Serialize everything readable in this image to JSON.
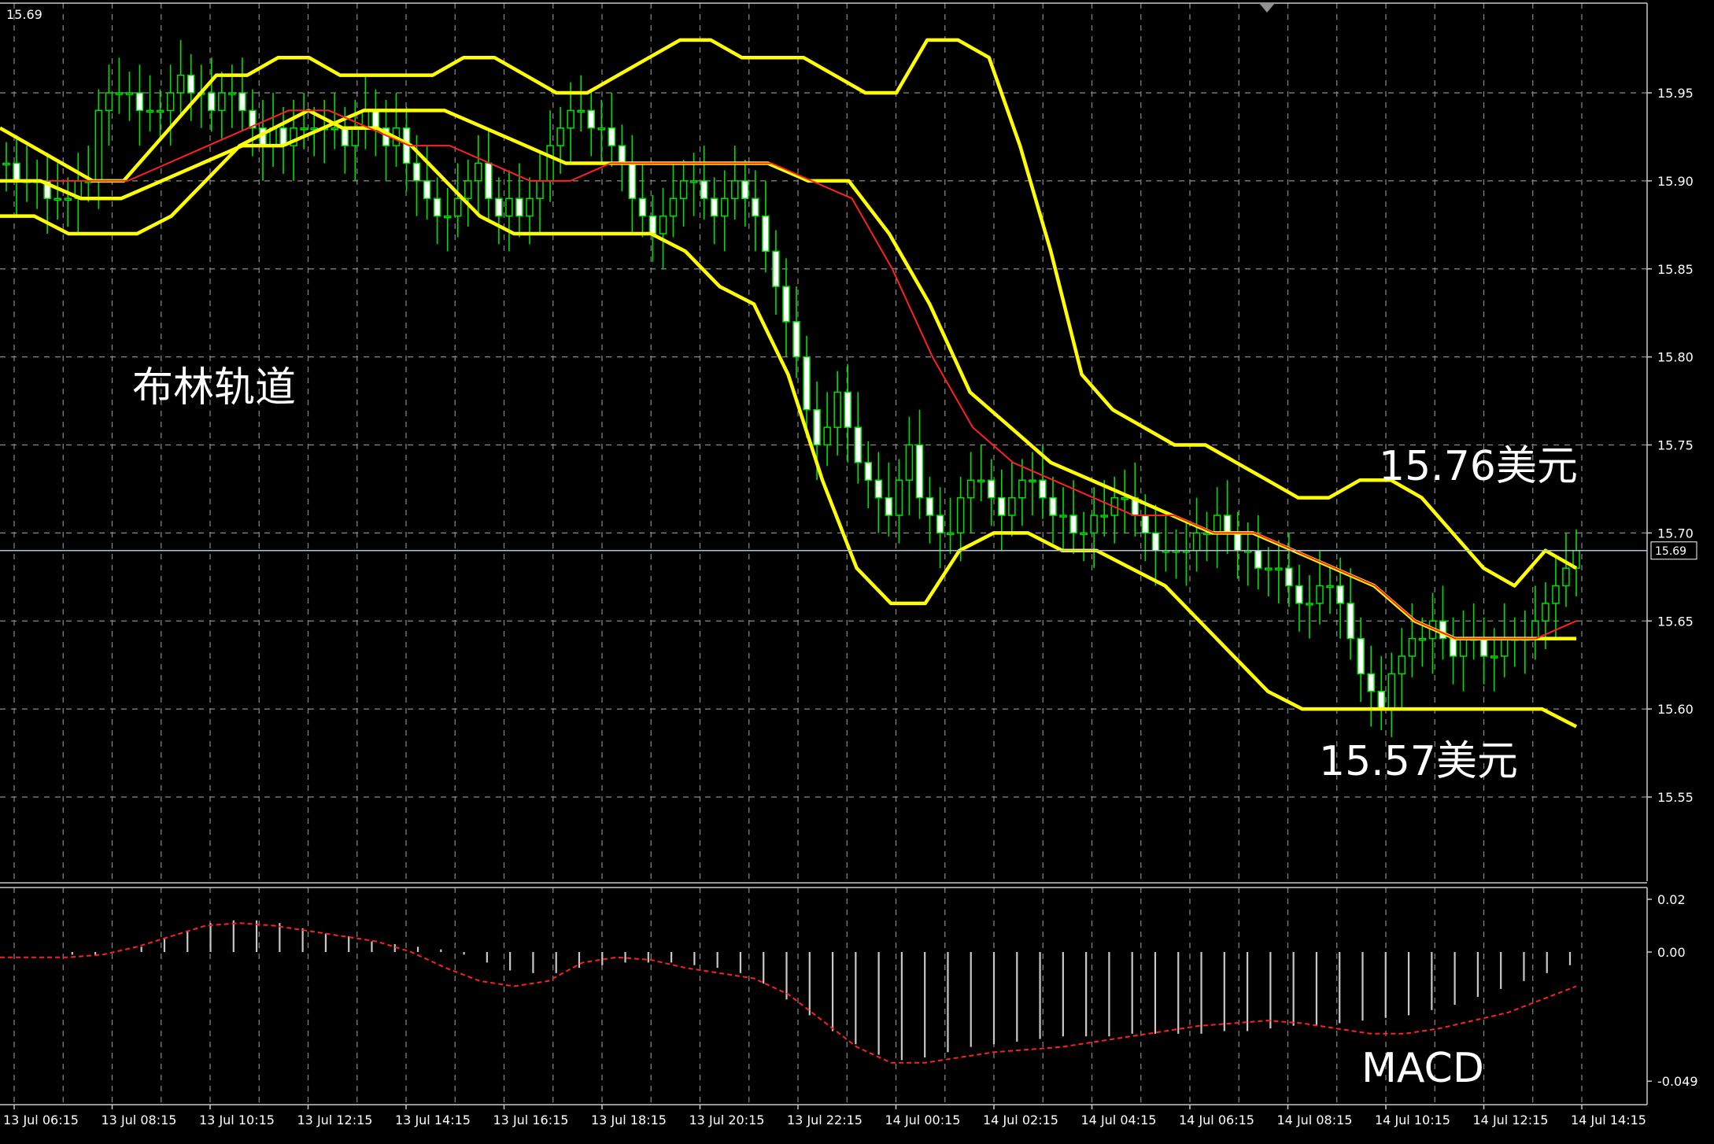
{
  "corner_price": "15.69",
  "current_price_label": "15.69",
  "annotations": {
    "bollinger": "布林轨道",
    "upper": "15.76美元",
    "lower": "15.57美元",
    "macd": "MACD"
  },
  "colors": {
    "background": "#000000",
    "grid": "#8a8a8a",
    "bull_candle": "#00e000",
    "band": "#ffff00",
    "ma": "#ff2020",
    "macd_hist": "#c8c8c8",
    "signal": "#ff2020",
    "price_line": "#a8c4d8"
  },
  "chart_data": [
    {
      "type": "candlestick",
      "indicator": "Bollinger Bands",
      "ylim": [
        15.5,
        16.0
      ],
      "y_ticks": [
        "15.95",
        "15.90",
        "15.85",
        "15.80",
        "15.75",
        "15.70",
        "15.65",
        "15.60",
        "15.55"
      ],
      "x_ticks": [
        "13 Jul 06:15",
        "13 Jul 08:15",
        "13 Jul 10:15",
        "13 Jul 12:15",
        "13 Jul 14:15",
        "13 Jul 16:15",
        "13 Jul 18:15",
        "13 Jul 20:15",
        "13 Jul 22:15",
        "14 Jul 00:15",
        "14 Jul 02:15",
        "14 Jul 04:15",
        "14 Jul 06:15",
        "14 Jul 08:15",
        "14 Jul 10:15",
        "14 Jul 12:15",
        "14 Jul 14:15"
      ],
      "x_tick_offsets": [
        0,
        8,
        16,
        24,
        32,
        40,
        48,
        56,
        64,
        72,
        80,
        88,
        96,
        104,
        112,
        120,
        128
      ],
      "current_price": 15.69,
      "close": [
        15.91,
        15.9,
        15.9,
        15.9,
        15.89,
        15.89,
        15.89,
        15.9,
        15.9,
        15.94,
        15.95,
        15.95,
        15.95,
        15.94,
        15.94,
        15.94,
        15.95,
        15.96,
        15.95,
        15.95,
        15.94,
        15.95,
        15.95,
        15.94,
        15.93,
        15.92,
        15.93,
        15.92,
        15.93,
        15.93,
        15.93,
        15.93,
        15.93,
        15.92,
        15.93,
        15.94,
        15.93,
        15.92,
        15.93,
        15.91,
        15.9,
        15.89,
        15.88,
        15.88,
        15.89,
        15.9,
        15.91,
        15.89,
        15.88,
        15.89,
        15.88,
        15.89,
        15.9,
        15.92,
        15.93,
        15.94,
        15.94,
        15.93,
        15.93,
        15.92,
        15.91,
        15.89,
        15.88,
        15.87,
        15.88,
        15.89,
        15.9,
        15.9,
        15.89,
        15.88,
        15.89,
        15.9,
        15.89,
        15.88,
        15.86,
        15.84,
        15.82,
        15.8,
        15.77,
        15.75,
        15.76,
        15.78,
        15.76,
        15.74,
        15.73,
        15.72,
        15.71,
        15.73,
        15.75,
        15.72,
        15.71,
        15.7,
        15.7,
        15.72,
        15.73,
        15.73,
        15.72,
        15.71,
        15.72,
        15.73,
        15.73,
        15.72,
        15.71,
        15.71,
        15.7,
        15.7,
        15.71,
        15.71,
        15.72,
        15.72,
        15.71,
        15.7,
        15.69,
        15.69,
        15.69,
        15.69,
        15.7,
        15.7,
        15.71,
        15.7,
        15.69,
        15.69,
        15.68,
        15.68,
        15.68,
        15.67,
        15.66,
        15.66,
        15.67,
        15.67,
        15.66,
        15.64,
        15.62,
        15.61,
        15.6,
        15.62,
        15.63,
        15.64,
        15.64,
        15.65,
        15.64,
        15.63,
        15.64,
        15.64,
        15.63,
        15.63,
        15.64,
        15.64,
        15.64,
        15.65,
        15.66,
        15.67,
        15.68,
        15.69
      ],
      "bands": {
        "upper": [
          15.93,
          15.92,
          15.91,
          15.9,
          15.9,
          15.92,
          15.94,
          15.96,
          15.96,
          15.97,
          15.97,
          15.96,
          15.96,
          15.96,
          15.96,
          15.97,
          15.97,
          15.96,
          15.95,
          15.95,
          15.96,
          15.97,
          15.98,
          15.98,
          15.97,
          15.97,
          15.97,
          15.96,
          15.95,
          15.95,
          15.98,
          15.98,
          15.97,
          15.92,
          15.86,
          15.79,
          15.77,
          15.76,
          15.75,
          15.75,
          15.74,
          15.73,
          15.72,
          15.72,
          15.73,
          15.73,
          15.72,
          15.7,
          15.68,
          15.67,
          15.69,
          15.68
        ],
        "middle": [
          15.9,
          15.9,
          15.89,
          15.89,
          15.9,
          15.91,
          15.92,
          15.92,
          15.93,
          15.94,
          15.94,
          15.94,
          15.93,
          15.92,
          15.91,
          15.91,
          15.91,
          15.91,
          15.91,
          15.91,
          15.9,
          15.9,
          15.87,
          15.83,
          15.78,
          15.76,
          15.74,
          15.73,
          15.72,
          15.71,
          15.7,
          15.7,
          15.69,
          15.68,
          15.67,
          15.65,
          15.64,
          15.64,
          15.64,
          15.64
        ],
        "lower": [
          15.88,
          15.88,
          15.87,
          15.87,
          15.87,
          15.88,
          15.9,
          15.92,
          15.93,
          15.94,
          15.93,
          15.93,
          15.92,
          15.9,
          15.88,
          15.87,
          15.87,
          15.87,
          15.87,
          15.87,
          15.86,
          15.84,
          15.83,
          15.79,
          15.73,
          15.68,
          15.66,
          15.66,
          15.69,
          15.7,
          15.7,
          15.69,
          15.69,
          15.68,
          15.67,
          15.65,
          15.63,
          15.61,
          15.6,
          15.6,
          15.6,
          15.6,
          15.6,
          15.6,
          15.6,
          15.6,
          15.59
        ]
      },
      "ma": [
        15.9,
        15.9,
        15.9,
        15.91,
        15.92,
        15.93,
        15.94,
        15.94,
        15.93,
        15.92,
        15.92,
        15.91,
        15.9,
        15.9,
        15.91,
        15.91,
        15.91,
        15.91,
        15.91,
        15.9,
        15.89,
        15.85,
        15.8,
        15.76,
        15.74,
        15.73,
        15.72,
        15.71,
        15.71,
        15.7,
        15.7,
        15.69,
        15.68,
        15.67,
        15.65,
        15.64,
        15.64,
        15.64,
        15.65
      ]
    },
    {
      "type": "bar",
      "indicator": "MACD",
      "y_ticks": [
        "0.02",
        "0.00",
        "-0.049"
      ],
      "ylim": [
        -0.049,
        0.02
      ],
      "histogram": [
        0.0,
        0.0,
        0.0,
        -0.001,
        -0.001,
        0.0,
        0.002,
        0.005,
        0.008,
        0.011,
        0.012,
        0.012,
        0.011,
        0.009,
        0.007,
        0.006,
        0.004,
        0.003,
        0.002,
        0.001,
        -0.001,
        -0.004,
        -0.007,
        -0.008,
        -0.008,
        -0.006,
        -0.005,
        -0.004,
        -0.004,
        -0.004,
        -0.005,
        -0.006,
        -0.008,
        -0.012,
        -0.018,
        -0.024,
        -0.03,
        -0.035,
        -0.039,
        -0.041,
        -0.04,
        -0.038,
        -0.036,
        -0.035,
        -0.034,
        -0.033,
        -0.032,
        -0.032,
        -0.032,
        -0.031,
        -0.031,
        -0.031,
        -0.031,
        -0.03,
        -0.03,
        -0.029,
        -0.028,
        -0.028,
        -0.027,
        -0.026,
        -0.025,
        -0.024,
        -0.022,
        -0.02,
        -0.017,
        -0.014,
        -0.011,
        -0.008,
        -0.005
      ],
      "signal": [
        -0.002,
        -0.002,
        -0.002,
        -0.001,
        0.002,
        0.006,
        0.01,
        0.011,
        0.01,
        0.008,
        0.006,
        0.004,
        0.0,
        -0.006,
        -0.011,
        -0.013,
        -0.011,
        -0.004,
        -0.002,
        -0.003,
        -0.006,
        -0.008,
        -0.01,
        -0.016,
        -0.026,
        -0.036,
        -0.042,
        -0.042,
        -0.04,
        -0.038,
        -0.037,
        -0.036,
        -0.034,
        -0.032,
        -0.03,
        -0.028,
        -0.027,
        -0.026,
        -0.027,
        -0.029,
        -0.031,
        -0.031,
        -0.029,
        -0.026,
        -0.023,
        -0.018,
        -0.013
      ]
    }
  ]
}
